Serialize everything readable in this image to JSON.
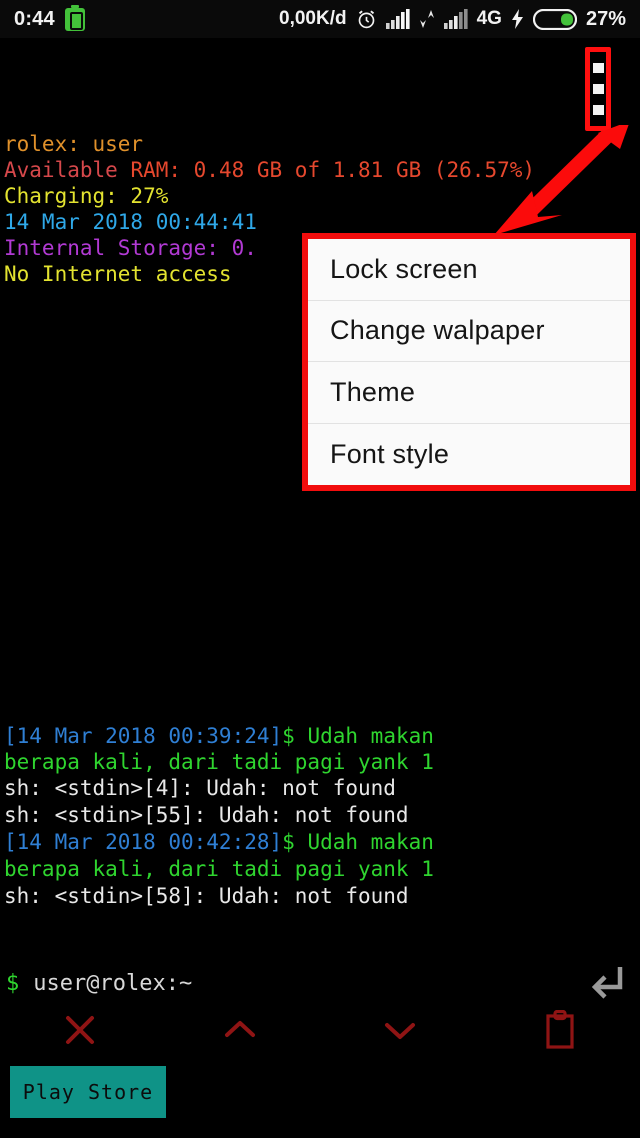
{
  "status_bar": {
    "time": "0:44",
    "battery_saver_icon": "battery-saver-icon",
    "network_speed": "0,00K/d",
    "alarm_icon": "alarm-clock-icon",
    "signal_1_icon": "signal-bars-icon",
    "data_transfer_icon": "data-transfer-icon",
    "signal_2_icon": "signal-bars-icon",
    "network_type": "4G",
    "charging_icon": "charging-bolt-icon",
    "battery_icon": "battery-icon",
    "battery_percent": "27%"
  },
  "terminal": {
    "header_lines": [
      {
        "text": "rolex: user",
        "color": "#e0912b"
      },
      {
        "text": "Available RAM: 0.48 GB of 1.81 GB (26.57%)",
        "color": "#d6484b"
      },
      {
        "text": "Charging: 27%",
        "color": "#e3e330"
      },
      {
        "text": "14 Mar 2018 00:44:41",
        "color": "#2fa8e8"
      },
      {
        "text": "Internal Storage: 0.",
        "color": "#b23ad4"
      },
      {
        "text": "No Internet access",
        "color": "#e3e330"
      }
    ],
    "header_ram_prefix": "Available",
    "header_ram_rest": " RAM: 0.48 GB of 1.81 GB (26.57%)",
    "history": [
      {
        "type": "command",
        "timestamp": "[14 Mar 2018 00:39:24]",
        "sigil": "$",
        "command": " Udah makan"
      },
      {
        "type": "command_wrap",
        "text": "berapa kali, dari tadi pagi yank 1"
      },
      {
        "type": "error",
        "text": "sh: <stdin>[4]: Udah: not found"
      },
      {
        "type": "error",
        "text": "sh: <stdin>[55]: Udah: not found"
      },
      {
        "type": "command",
        "timestamp": "[14 Mar 2018 00:42:28]",
        "sigil": "$",
        "command": " Udah makan"
      },
      {
        "type": "command_wrap",
        "text": "berapa kali, dari tadi pagi yank 1"
      },
      {
        "type": "error",
        "text": "sh: <stdin>[58]: Udah: not found"
      }
    ],
    "prompt": {
      "sigil": "$",
      "text": "user@rolex:~",
      "input_value": "",
      "enter_icon": "enter-return-icon"
    }
  },
  "overflow_menu_button": {
    "name": "overflow-menu-button",
    "highlight_color": "#ff0f0f",
    "dot_count": 3
  },
  "annotation": {
    "arrow_color": "#fb0b0b",
    "arrow_name": "annotation-arrow"
  },
  "popup_menu": {
    "border_color": "#f20d0d",
    "items": [
      {
        "label": "Lock screen"
      },
      {
        "label": "Change walpaper"
      },
      {
        "label": "Theme"
      },
      {
        "label": "Font style"
      }
    ]
  },
  "toolbar": {
    "icon_color": "#8f1414",
    "buttons": [
      {
        "name": "close-icon",
        "glyph": "x"
      },
      {
        "name": "chevron-up-icon",
        "glyph": "up"
      },
      {
        "name": "chevron-down-icon",
        "glyph": "down"
      },
      {
        "name": "paste-clipboard-icon",
        "glyph": "clipboard"
      }
    ]
  },
  "play_store_button": {
    "label": "Play Store",
    "background": "#0f9387"
  }
}
